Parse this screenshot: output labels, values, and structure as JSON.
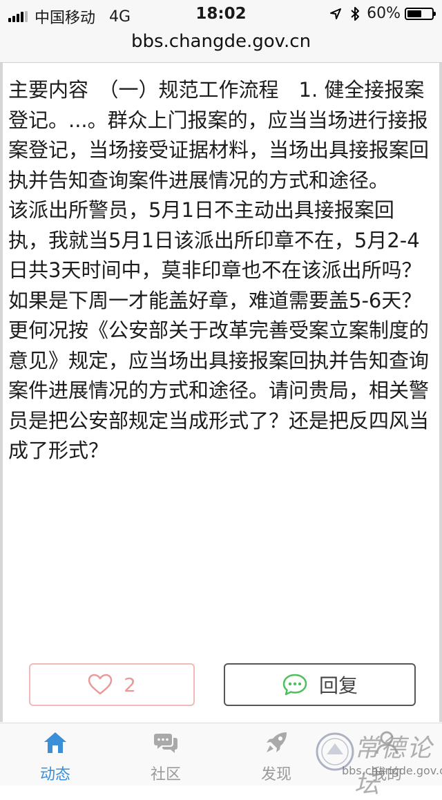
{
  "status_bar": {
    "carrier": "中国移动",
    "network": "4G",
    "time": "18:02",
    "battery": "60%",
    "battery_level": 0.6
  },
  "browser": {
    "url": "bbs.changde.gov.cn"
  },
  "post": {
    "body": "主要内容　（一）规范工作流程　1. 健全接报案登记。...。群众上门报案的，应当当场进行接报案登记，当场接受证据材料，当场出具接报案回执并告知查询案件进展情况的方式和途径。\n该派出所警员，5月1日不主动出具接报案回执，我就当5月1日该派出所印章不在，5月2-4日共3天时间中，莫非印章也不在该派出所吗？如果是下周一才能盖好章，难道需要盖5-6天？更何况按《公安部关于改革完善受案立案制度的意见》规定，应当场出具接报案回执并告知查询案件进展情况的方式和途径。请问贵局，相关警员是把公安部规定当成形式了？还是把反四风当成了形式？"
  },
  "actions": {
    "like_count": "2",
    "reply_label": "回复"
  },
  "tabs": [
    {
      "label": "动态",
      "icon": "home-icon",
      "active": true
    },
    {
      "label": "社区",
      "icon": "chat-icon",
      "active": false
    },
    {
      "label": "发现",
      "icon": "rocket-icon",
      "active": false
    },
    {
      "label": "我的",
      "icon": "user-icon",
      "active": false
    }
  ],
  "watermark": {
    "title": "常德论坛",
    "url": "bbs.changde.gov.cn"
  },
  "colors": {
    "accent": "#3b8fd8",
    "like": "#e89a9a",
    "reply_icon": "#4cc05a"
  }
}
